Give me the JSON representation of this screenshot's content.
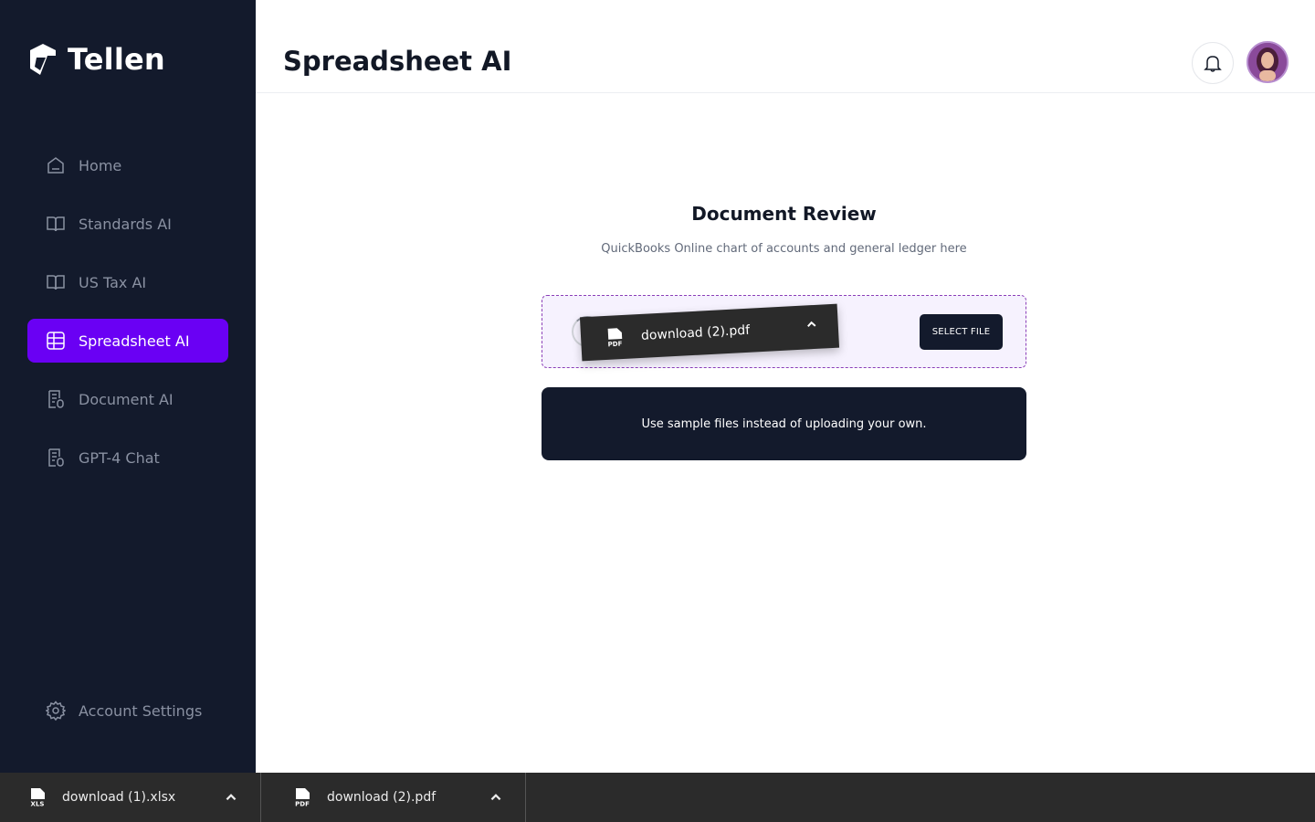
{
  "app": {
    "name": "Tellen"
  },
  "sidebar": {
    "items": [
      {
        "label": "Home",
        "icon": "home-icon"
      },
      {
        "label": "Standards AI",
        "icon": "book-icon"
      },
      {
        "label": "US Tax AI",
        "icon": "book-icon"
      },
      {
        "label": "Spreadsheet AI",
        "icon": "table-icon",
        "active": true
      },
      {
        "label": "Document AI",
        "icon": "document-icon"
      },
      {
        "label": "GPT-4 Chat",
        "icon": "document-icon"
      }
    ],
    "settings": {
      "label": "Account Settings",
      "icon": "gear-icon"
    }
  },
  "header": {
    "title": "Spreadsheet AI"
  },
  "main": {
    "title": "Document Review",
    "subtitle": "QuickBooks Online chart of accounts and general ledger here",
    "dropzone": {
      "select_label": "SELECT FILE"
    },
    "drag_chip": {
      "file_name": "download (2).pdf",
      "file_type": "PDF"
    },
    "sample_label": "Use sample files instead of uploading your own."
  },
  "downloads": [
    {
      "file_name": "download (1).xlsx",
      "file_type": "XLS"
    },
    {
      "file_name": "download (2).pdf",
      "file_type": "PDF"
    }
  ],
  "colors": {
    "sidebar_bg": "#131a2c",
    "accent": "#6a00f4",
    "dropzone_border": "#8b3fb8",
    "downloads_bg": "#2b2b2b"
  }
}
